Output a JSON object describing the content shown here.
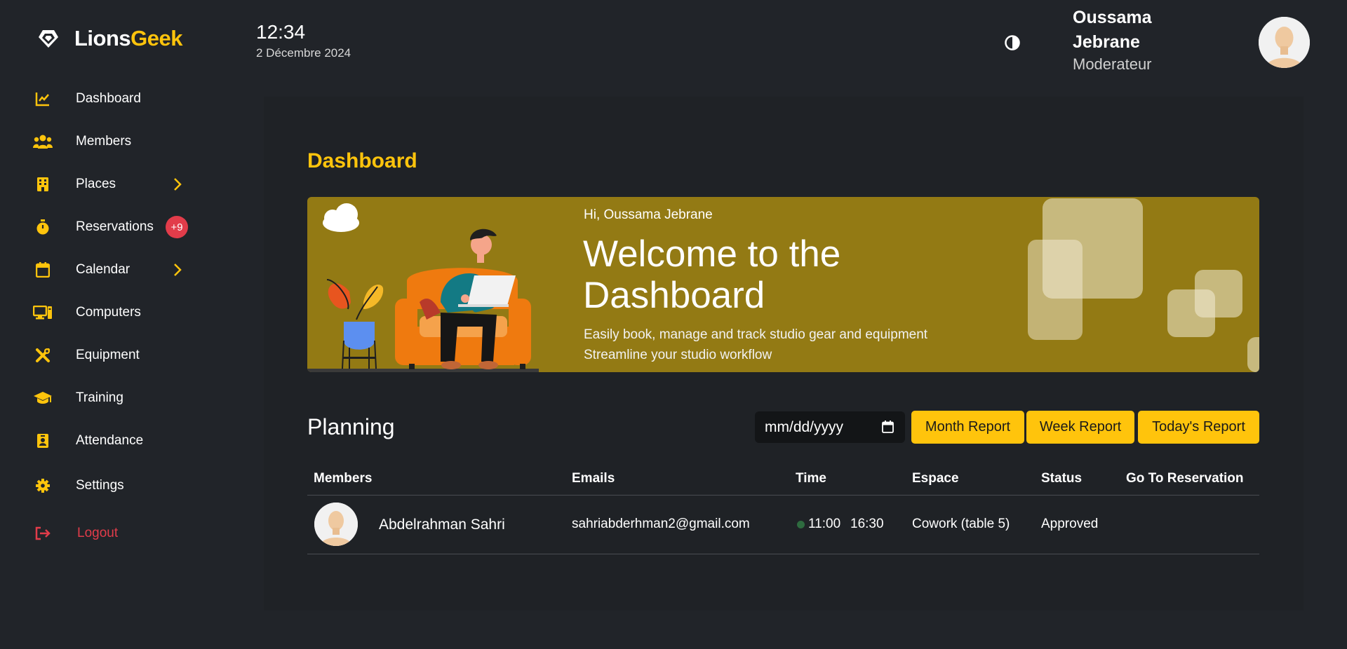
{
  "brand": {
    "name_part1": "Lions",
    "name_part2": "Geek"
  },
  "sidebar": {
    "items": [
      {
        "label": "Dashboard",
        "icon": "chart-line-icon"
      },
      {
        "label": "Members",
        "icon": "users-icon"
      },
      {
        "label": "Places",
        "icon": "building-icon",
        "has_submenu": true
      },
      {
        "label": "Reservations",
        "icon": "stopwatch-icon",
        "badge": "+9"
      },
      {
        "label": "Calendar",
        "icon": "calendar-icon",
        "has_submenu": true
      },
      {
        "label": "Computers",
        "icon": "computer-icon"
      },
      {
        "label": "Equipment",
        "icon": "tools-icon"
      },
      {
        "label": "Training",
        "icon": "graduation-cap-icon"
      },
      {
        "label": "Attendance",
        "icon": "id-badge-icon"
      },
      {
        "label": "Settings",
        "icon": "gear-icon"
      },
      {
        "label": "Logout",
        "icon": "logout-icon"
      }
    ]
  },
  "header": {
    "time": "12:34",
    "date": "2 Décembre 2024",
    "user_first": "Oussama",
    "user_last": "Jebrane",
    "role": "Moderateur"
  },
  "main": {
    "title": "Dashboard",
    "banner": {
      "greeting": "Hi, Oussama Jebrane",
      "headline_line1": "Welcome to the",
      "headline_line2": "Dashboard",
      "sub_line1": "Easily book, manage and track studio gear and equipment",
      "sub_line2": "Streamline your studio workflow"
    },
    "planning": {
      "title": "Planning",
      "date_placeholder": "mm/dd/yyyy",
      "buttons": [
        "Month Report",
        "Week Report",
        "Today's Report"
      ],
      "columns": [
        "Members",
        "Emails",
        "Time",
        "Espace",
        "Status",
        "Go To Reservation"
      ],
      "rows": [
        {
          "member": "Abdelrahman Sahri",
          "email": "sahriabderhman2@gmail.com",
          "start": "11:00",
          "end": "16:30",
          "espace": "Cowork (table 5)",
          "status": "Approved"
        }
      ]
    }
  },
  "colors": {
    "accent": "#ffc40c",
    "background": "#212429",
    "banner": "#937a14",
    "danger": "#e23c4a"
  }
}
